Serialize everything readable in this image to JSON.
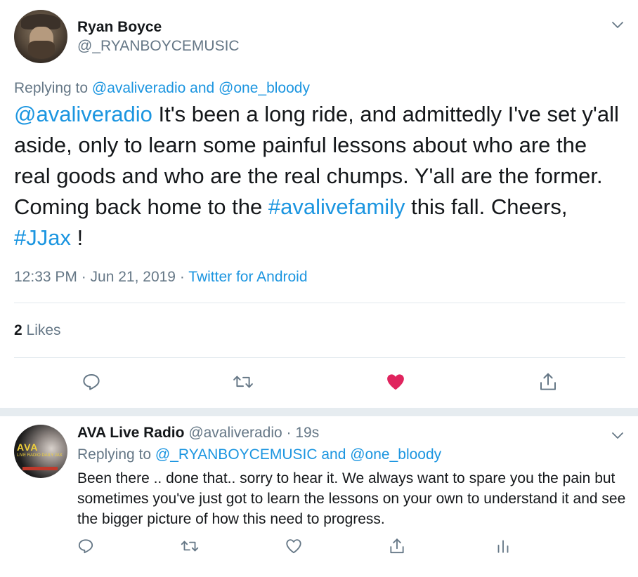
{
  "main_tweet": {
    "author": {
      "name": "Ryan Boyce",
      "handle": "@_RYANBOYCEMUSIC"
    },
    "replying_to": {
      "prefix": "Replying to",
      "user1": "@avaliveradio",
      "conjunction": "and",
      "user2": "@one_bloody"
    },
    "text": {
      "mention": "@avaliveradio",
      "body1": " It's been a long ride, and admittedly I've set y'all aside, only to learn some painful lessons about who are the real goods and who are the real chumps. Y'all are the former. Coming back home to the ",
      "hashtag1": "#avalivefamily",
      "body2": " this fall. Cheers, ",
      "hashtag2": "#JJax",
      "body3": " !"
    },
    "timestamp": "12:33 PM · Jun 21, 2019 · ",
    "source": "Twitter for Android",
    "likes_count": "2",
    "likes_label": " Likes",
    "liked": true
  },
  "reply_tweet": {
    "author": {
      "name": "AVA Live Radio",
      "handle": "@avaliveradio",
      "time_sep": " · ",
      "time": "19s"
    },
    "avatar_text": {
      "big": "AVA",
      "small": "LIVE RADIO DAILY JAX"
    },
    "replying_to": {
      "prefix": "Replying to",
      "user1": "@_RYANBOYCEMUSIC",
      "conjunction": "and",
      "user2": "@one_bloody"
    },
    "text": "Been there .. done that.. sorry to hear it. We always want to spare you the pain but sometimes you've just got to learn the lessons on your own to understand it and see the bigger picture of how this need to progress."
  },
  "colors": {
    "accent": "#1b95e0",
    "like": "#e0245e",
    "muted": "#657786",
    "text": "#14171a",
    "divider": "#e1e8ed"
  },
  "icons": {
    "more": "chevron-down-icon",
    "reply": "speech-bubble-icon",
    "retweet": "retweet-icon",
    "like": "heart-icon",
    "share": "share-icon",
    "analytics": "bar-chart-icon"
  }
}
